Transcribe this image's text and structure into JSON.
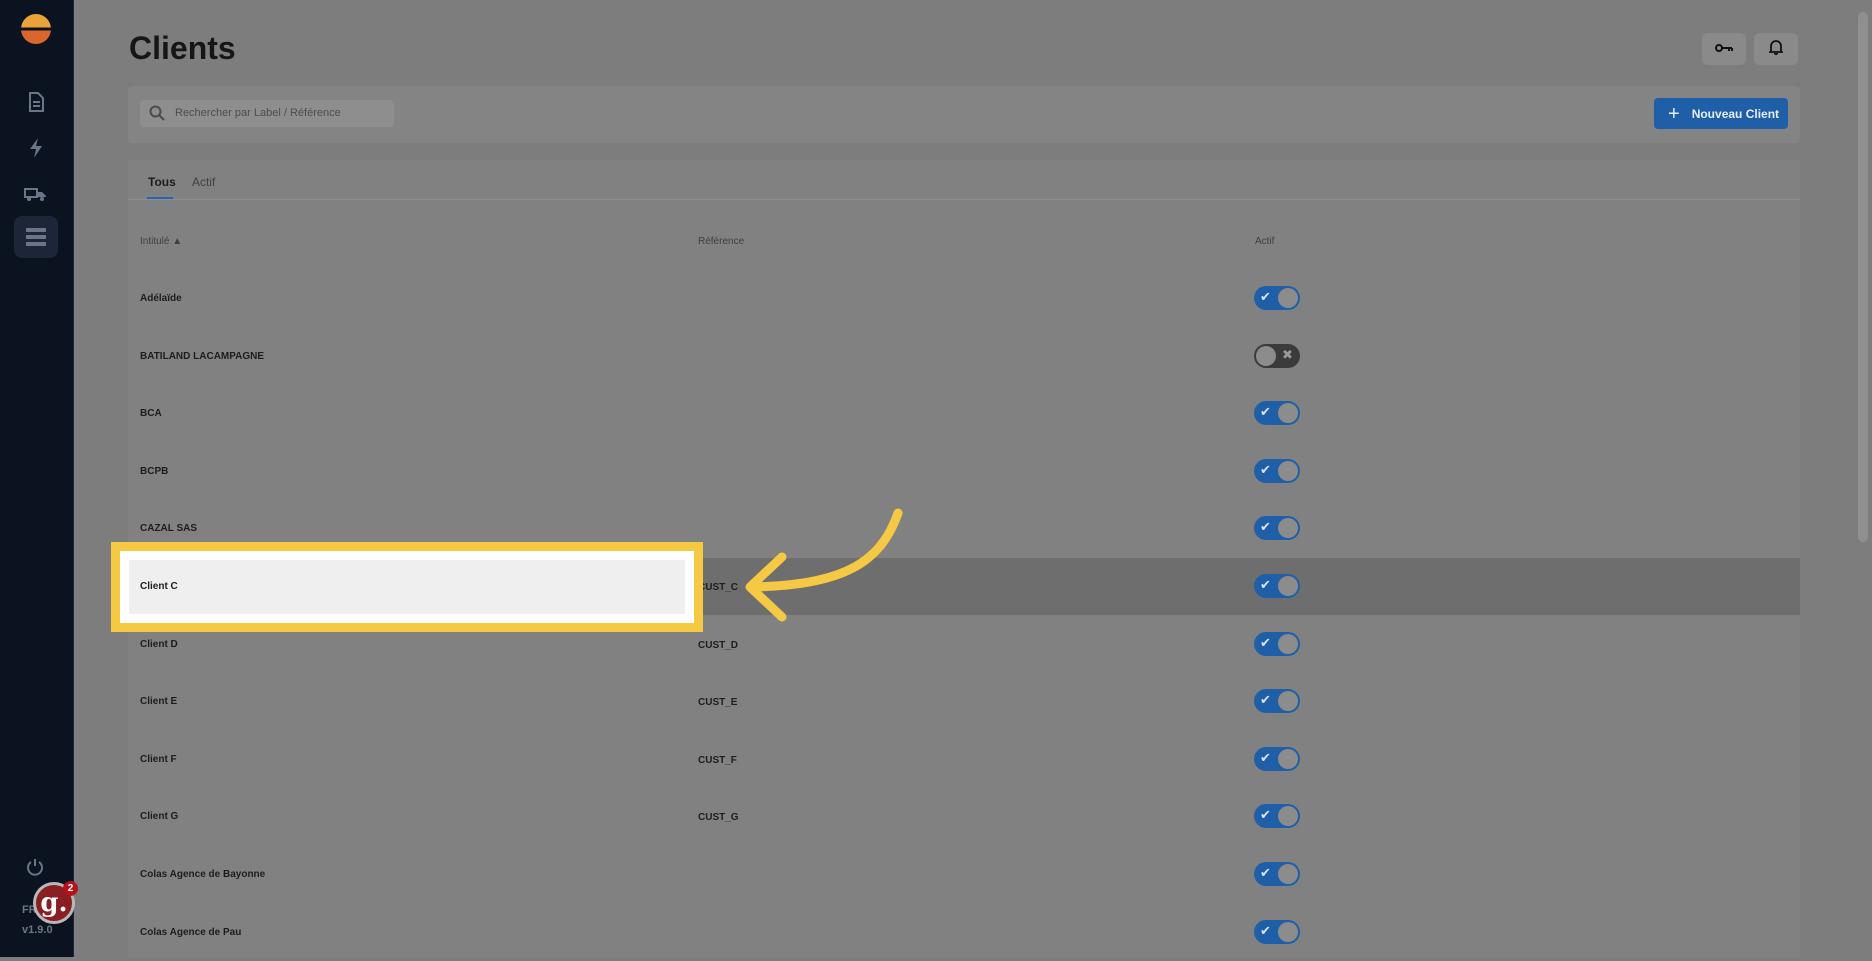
{
  "page": {
    "title": "Clients"
  },
  "sidebar": {
    "version": "v1.9.0",
    "language": "FR",
    "guide_count": "2",
    "items": [
      {
        "icon": "document-icon"
      },
      {
        "icon": "bolt-icon"
      },
      {
        "icon": "truck-icon"
      },
      {
        "icon": "list-icon"
      }
    ]
  },
  "toolbar": {
    "search_placeholder": "Rechercher par Label / Référence",
    "new_label": "Nouveau Client"
  },
  "tabs": [
    "Tous",
    "Actif"
  ],
  "table": {
    "headers": {
      "label": "Intitulé ▲",
      "reference": "Référence",
      "active": "Actif"
    },
    "rows": [
      {
        "label": "Adélaïde",
        "reference": "",
        "active": true
      },
      {
        "label": "BATILAND LACAMPAGNE",
        "reference": "",
        "active": false
      },
      {
        "label": "BCA",
        "reference": "",
        "active": true
      },
      {
        "label": "BCPB",
        "reference": "",
        "active": true
      },
      {
        "label": "CAZAL SAS",
        "reference": "",
        "active": true
      },
      {
        "label": "Client C",
        "reference": "CUST_C",
        "active": true
      },
      {
        "label": "Client D",
        "reference": "CUST_D",
        "active": true
      },
      {
        "label": "Client E",
        "reference": "CUST_E",
        "active": true
      },
      {
        "label": "Client F",
        "reference": "CUST_F",
        "active": true
      },
      {
        "label": "Client G",
        "reference": "CUST_G",
        "active": true
      },
      {
        "label": "Colas Agence de Bayonne",
        "reference": "",
        "active": true
      },
      {
        "label": "Colas Agence de Pau",
        "reference": "",
        "active": true
      }
    ]
  },
  "colors": {
    "accent": "#1f5fa8",
    "highlight": "#f6c944"
  }
}
